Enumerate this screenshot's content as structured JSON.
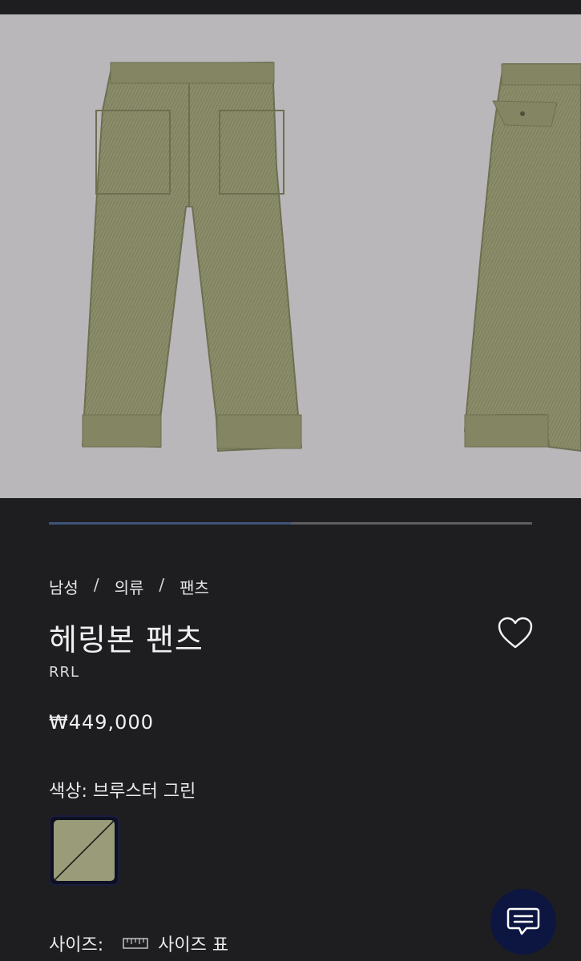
{
  "breadcrumb": [
    "남성",
    "의류",
    "팬츠"
  ],
  "breadcrumb_separator": "/",
  "product": {
    "title": "헤링본 팬츠",
    "brand": "RRL",
    "price": "₩449,000",
    "color_label": "색상: 브루스터 그린",
    "size_label": "사이즈:",
    "size_guide_label": "사이즈 표"
  },
  "gallery": {
    "progress": 0.5,
    "images": [
      "front view",
      "back view"
    ]
  },
  "icons": {
    "favorite": "heart-outline-icon",
    "chat": "chat-bubble-icon",
    "size_guide": "ruler-icon"
  },
  "colors": {
    "background": "#1e1e20",
    "photo_bg": "#b9b7ba",
    "progress_fill": "#3e5378",
    "chat_button": "#0c1640",
    "swatch": "#9a9b78"
  }
}
